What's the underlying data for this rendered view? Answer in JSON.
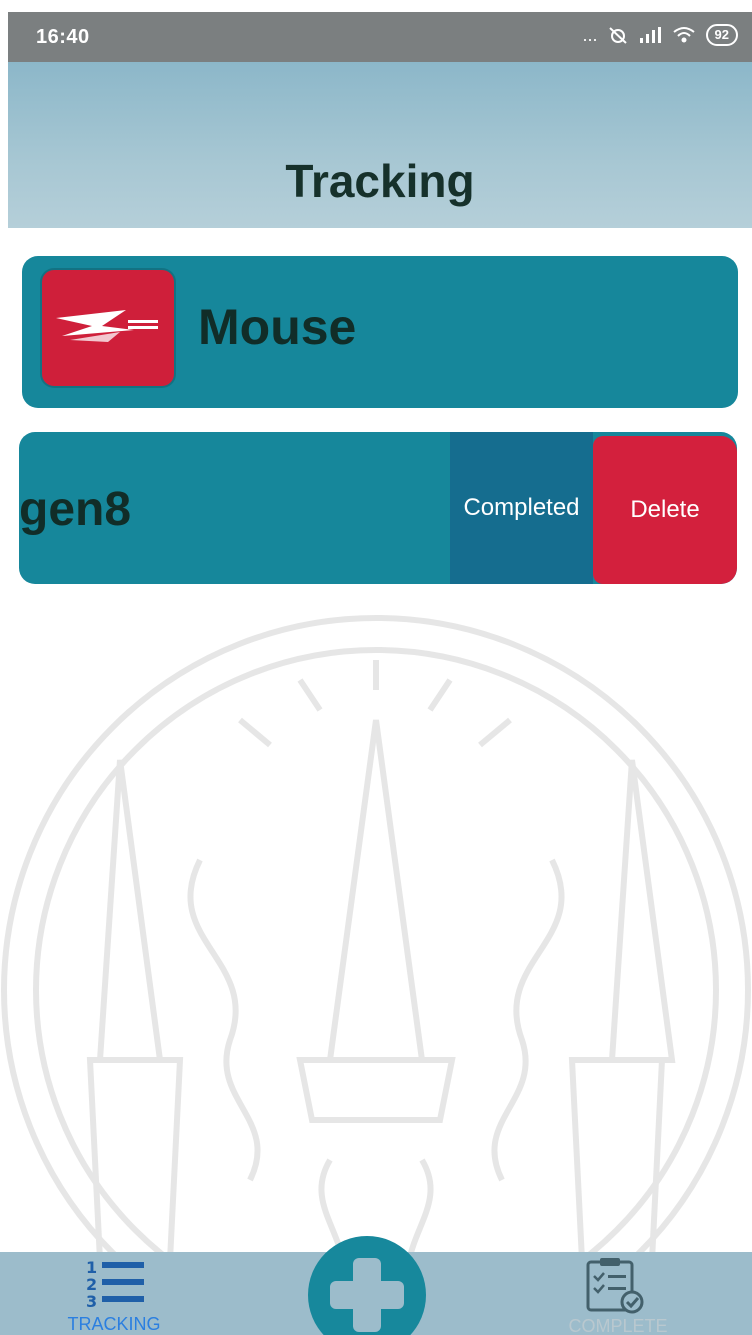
{
  "status_bar": {
    "time": "16:40",
    "icons_text": "...",
    "battery": "92",
    "icon_names": [
      "dots-icon",
      "alarm-off-icon",
      "signal-icon",
      "wifi-icon",
      "battery-icon"
    ]
  },
  "header": {
    "title": "Tracking"
  },
  "tracking_items": [
    {
      "name": "Mouse",
      "carrier_logo": "thailand-post-logo"
    },
    {
      "name": "gen8"
    }
  ],
  "swipe_actions": {
    "completed_label": "Completed",
    "delete_label": "Delete"
  },
  "bottom_nav": {
    "tracking_label": "TRACKING",
    "complete_label": "COMPLETE",
    "add_icon": "plus-icon"
  },
  "colors": {
    "header_bg": "#a7c7d3",
    "card_bg": "#16879b",
    "completed_bg": "#156d8f",
    "delete_bg": "#d3203d",
    "logo_bg": "#cf1f3a",
    "nav_bg": "#9cbccb",
    "nav_active": "#2b7fe0"
  }
}
